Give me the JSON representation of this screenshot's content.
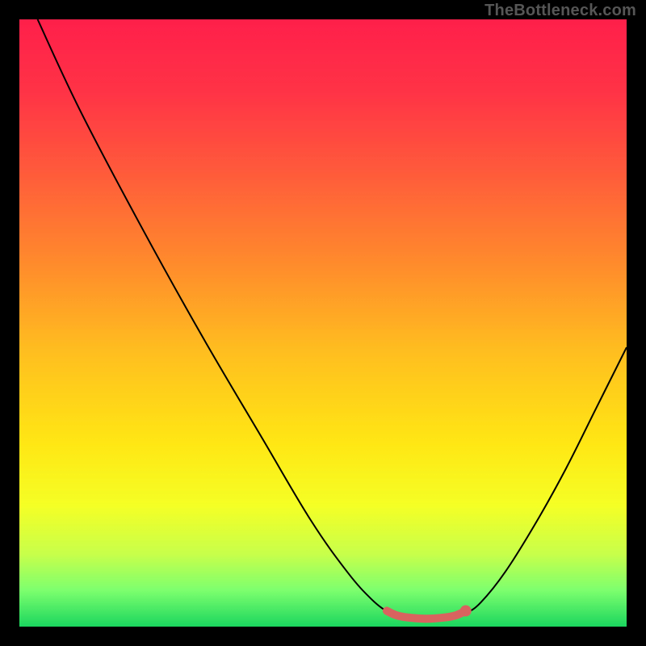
{
  "watermark": "TheBottleneck.com",
  "chart_data": {
    "type": "line",
    "title": "",
    "xlabel": "",
    "ylabel": "",
    "xlim": [
      0,
      100
    ],
    "ylim": [
      0,
      100
    ],
    "background_gradient": {
      "stops": [
        {
          "offset": 0.0,
          "color": "#ff1f4a"
        },
        {
          "offset": 0.12,
          "color": "#ff3346"
        },
        {
          "offset": 0.25,
          "color": "#ff5a3b"
        },
        {
          "offset": 0.4,
          "color": "#ff8a2c"
        },
        {
          "offset": 0.55,
          "color": "#ffbf1f"
        },
        {
          "offset": 0.7,
          "color": "#ffe714"
        },
        {
          "offset": 0.8,
          "color": "#f5ff25"
        },
        {
          "offset": 0.88,
          "color": "#c8ff4a"
        },
        {
          "offset": 0.94,
          "color": "#7dff6e"
        },
        {
          "offset": 1.0,
          "color": "#1bd65e"
        }
      ]
    },
    "series": [
      {
        "name": "bottleneck-curve",
        "color": "#000000",
        "stroke_width": 2,
        "points": [
          {
            "x": 3.0,
            "y": 100.0
          },
          {
            "x": 10.0,
            "y": 85.0
          },
          {
            "x": 20.0,
            "y": 66.0
          },
          {
            "x": 30.0,
            "y": 48.0
          },
          {
            "x": 40.0,
            "y": 31.0
          },
          {
            "x": 48.0,
            "y": 17.5
          },
          {
            "x": 54.0,
            "y": 9.0
          },
          {
            "x": 58.0,
            "y": 4.5
          },
          {
            "x": 61.0,
            "y": 2.2
          },
          {
            "x": 63.0,
            "y": 1.5
          },
          {
            "x": 67.0,
            "y": 1.3
          },
          {
            "x": 71.0,
            "y": 1.5
          },
          {
            "x": 73.5,
            "y": 2.2
          },
          {
            "x": 76.0,
            "y": 4.0
          },
          {
            "x": 80.0,
            "y": 9.0
          },
          {
            "x": 85.0,
            "y": 17.0
          },
          {
            "x": 90.0,
            "y": 26.0
          },
          {
            "x": 95.0,
            "y": 36.0
          },
          {
            "x": 100.0,
            "y": 46.0
          }
        ]
      },
      {
        "name": "optimal-highlight",
        "color": "#d9645f",
        "stroke_width": 10,
        "linecap": "round",
        "points": [
          {
            "x": 60.5,
            "y": 2.6
          },
          {
            "x": 62.0,
            "y": 1.9
          },
          {
            "x": 64.0,
            "y": 1.5
          },
          {
            "x": 67.0,
            "y": 1.3
          },
          {
            "x": 70.0,
            "y": 1.5
          },
          {
            "x": 72.0,
            "y": 1.9
          },
          {
            "x": 73.5,
            "y": 2.6
          }
        ]
      }
    ],
    "markers": [
      {
        "name": "optimal-dot",
        "x": 73.5,
        "y": 2.6,
        "r": 7,
        "color": "#d9645f"
      }
    ]
  }
}
